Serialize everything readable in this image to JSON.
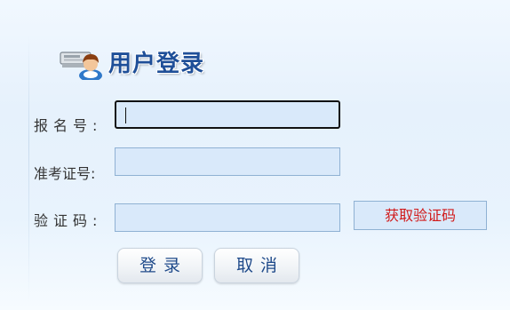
{
  "title": "用户登录",
  "form": {
    "exam_no": {
      "label": "报名号:",
      "value": ""
    },
    "id_no": {
      "label": "准考证号:",
      "value": ""
    },
    "captcha": {
      "label": "验证码:",
      "value": ""
    }
  },
  "buttons": {
    "get_code": "获取验证码",
    "login": "登录",
    "cancel": "取消"
  },
  "icons": {
    "title_icon": "user-login-icon"
  },
  "colors": {
    "accent": "#1f4f98",
    "field_bg": "#d9e9fa",
    "code_text": "#d11a1a"
  }
}
